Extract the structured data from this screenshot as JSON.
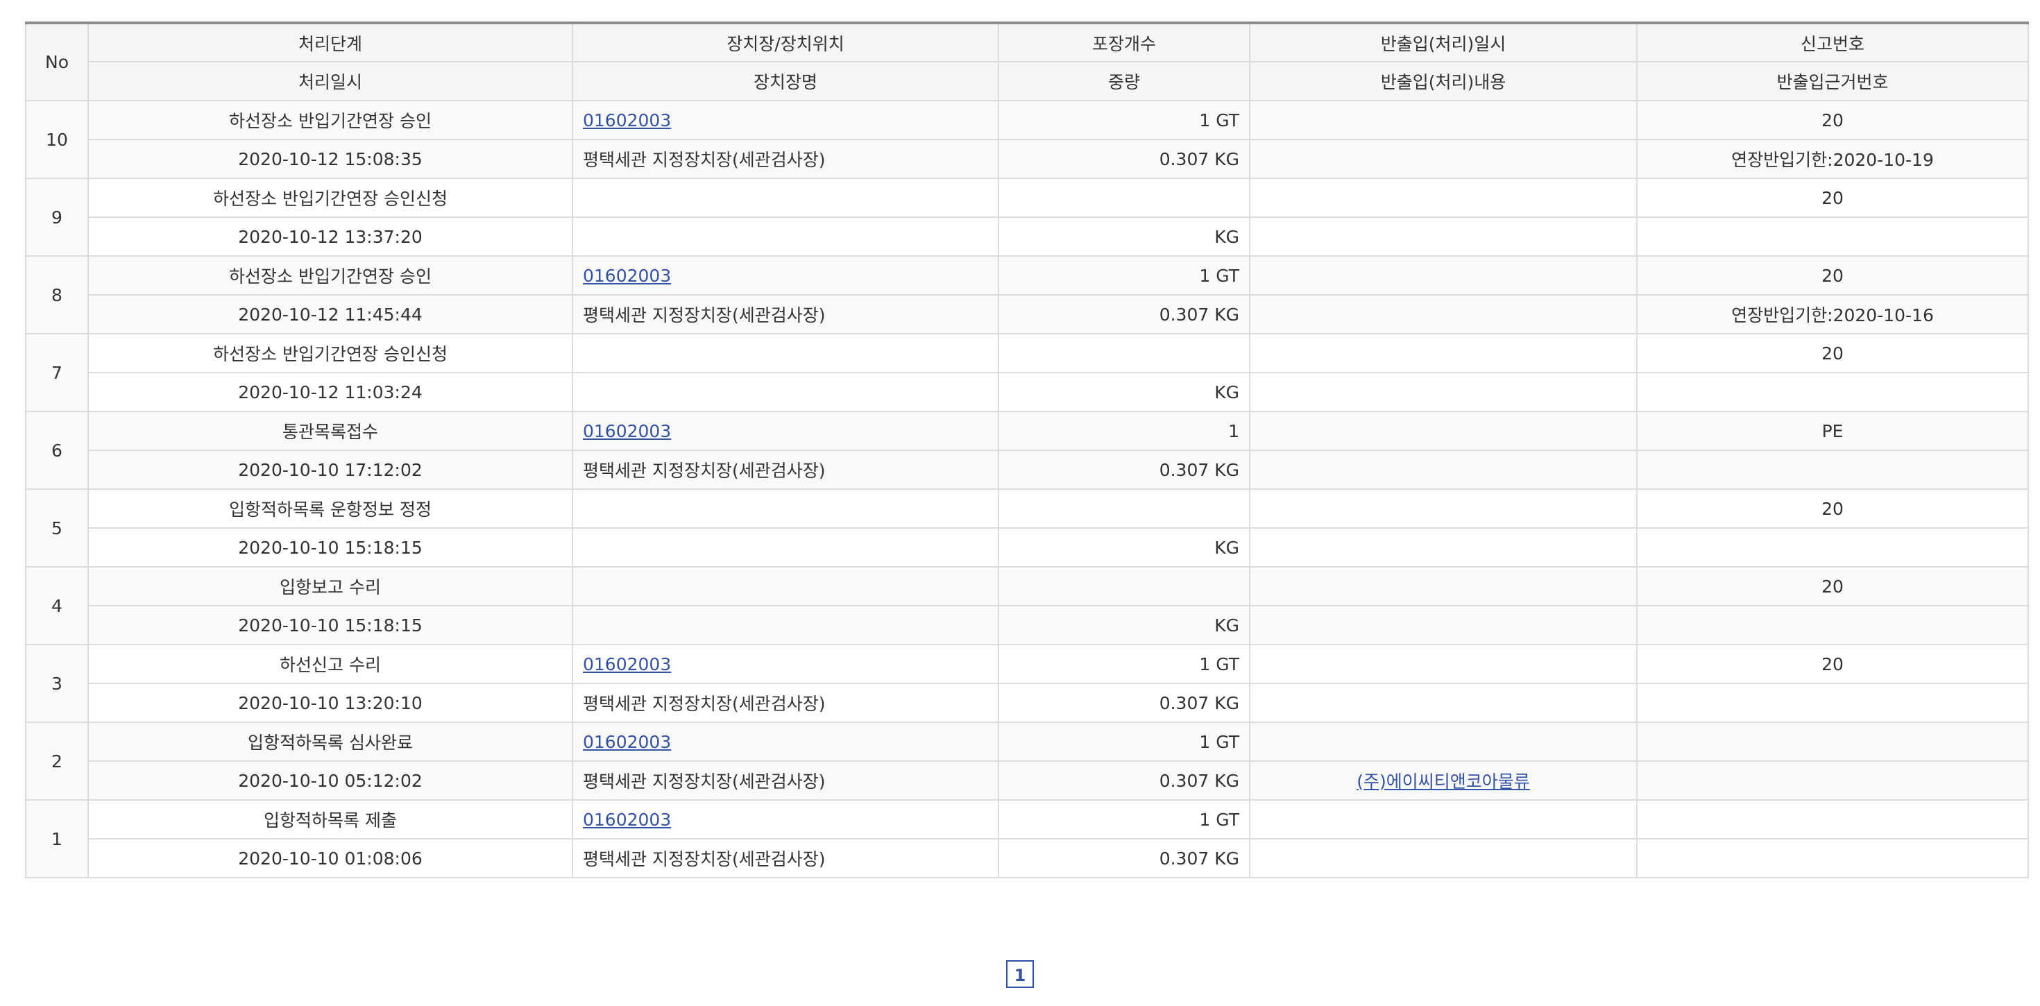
{
  "headers": {
    "no": "No",
    "top": [
      "처리단계",
      "장치장/장치위치",
      "포장개수",
      "반출입(처리)일시",
      "신고번호"
    ],
    "bottom": [
      "처리일시",
      "장치장명",
      "중량",
      "반출입(처리)내용",
      "반출입근거번호"
    ]
  },
  "rows": [
    {
      "no": "10",
      "stage": "하선장소 반입기간연장 승인",
      "location_code": "01602003",
      "packages": "1 GT",
      "inout_datetime": "",
      "report_no": "20",
      "processed_at": "2020-10-12 15:08:35",
      "warehouse_name": "평택세관 지정장치장(세관검사장)",
      "weight": "0.307 KG",
      "inout_content": "",
      "basis_no": "연장반입기한:2020-10-19"
    },
    {
      "no": "9",
      "stage": "하선장소 반입기간연장 승인신청",
      "location_code": "",
      "packages": "",
      "inout_datetime": "",
      "report_no": "20",
      "processed_at": "2020-10-12 13:37:20",
      "warehouse_name": "",
      "weight": "KG",
      "inout_content": "",
      "basis_no": ""
    },
    {
      "no": "8",
      "stage": "하선장소 반입기간연장 승인",
      "location_code": "01602003",
      "packages": "1 GT",
      "inout_datetime": "",
      "report_no": "20",
      "processed_at": "2020-10-12 11:45:44",
      "warehouse_name": "평택세관 지정장치장(세관검사장)",
      "weight": "0.307 KG",
      "inout_content": "",
      "basis_no": "연장반입기한:2020-10-16"
    },
    {
      "no": "7",
      "stage": "하선장소 반입기간연장 승인신청",
      "location_code": "",
      "packages": "",
      "inout_datetime": "",
      "report_no": "20",
      "processed_at": "2020-10-12 11:03:24",
      "warehouse_name": "",
      "weight": "KG",
      "inout_content": "",
      "basis_no": ""
    },
    {
      "no": "6",
      "stage": "통관목록접수",
      "location_code": "01602003",
      "packages": "1",
      "inout_datetime": "",
      "report_no": "PE",
      "processed_at": "2020-10-10 17:12:02",
      "warehouse_name": "평택세관 지정장치장(세관검사장)",
      "weight": "0.307 KG",
      "inout_content": "",
      "basis_no": ""
    },
    {
      "no": "5",
      "stage": "입항적하목록 운항정보 정정",
      "location_code": "",
      "packages": "",
      "inout_datetime": "",
      "report_no": "20",
      "processed_at": "2020-10-10 15:18:15",
      "warehouse_name": "",
      "weight": "KG",
      "inout_content": "",
      "basis_no": ""
    },
    {
      "no": "4",
      "stage": "입항보고 수리",
      "location_code": "",
      "packages": "",
      "inout_datetime": "",
      "report_no": "20",
      "processed_at": "2020-10-10 15:18:15",
      "warehouse_name": "",
      "weight": "KG",
      "inout_content": "",
      "basis_no": ""
    },
    {
      "no": "3",
      "stage": "하선신고 수리",
      "location_code": "01602003",
      "packages": "1 GT",
      "inout_datetime": "",
      "report_no": "20",
      "processed_at": "2020-10-10 13:20:10",
      "warehouse_name": "평택세관 지정장치장(세관검사장)",
      "weight": "0.307 KG",
      "inout_content": "",
      "basis_no": ""
    },
    {
      "no": "2",
      "stage": "입항적하목록 심사완료",
      "location_code": "01602003",
      "packages": "1 GT",
      "inout_datetime": "",
      "report_no": "",
      "processed_at": "2020-10-10 05:12:02",
      "warehouse_name": "평택세관 지정장치장(세관검사장)",
      "weight": "0.307 KG",
      "inout_content": "(주)에이씨티앤코아물류",
      "basis_no": ""
    },
    {
      "no": "1",
      "stage": "입항적하목록 제출",
      "location_code": "01602003",
      "packages": "1 GT",
      "inout_datetime": "",
      "report_no": "",
      "processed_at": "2020-10-10 01:08:06",
      "warehouse_name": "평택세관 지정장치장(세관검사장)",
      "weight": "0.307 KG",
      "inout_content": "",
      "basis_no": ""
    }
  ],
  "pagination": {
    "pages": [
      "1"
    ],
    "current": "1"
  },
  "colors": {
    "link": "#3353a6",
    "border": "#dcdcdc",
    "header_bg": "#f5f5f5",
    "top_rule": "#8c8c8c"
  }
}
